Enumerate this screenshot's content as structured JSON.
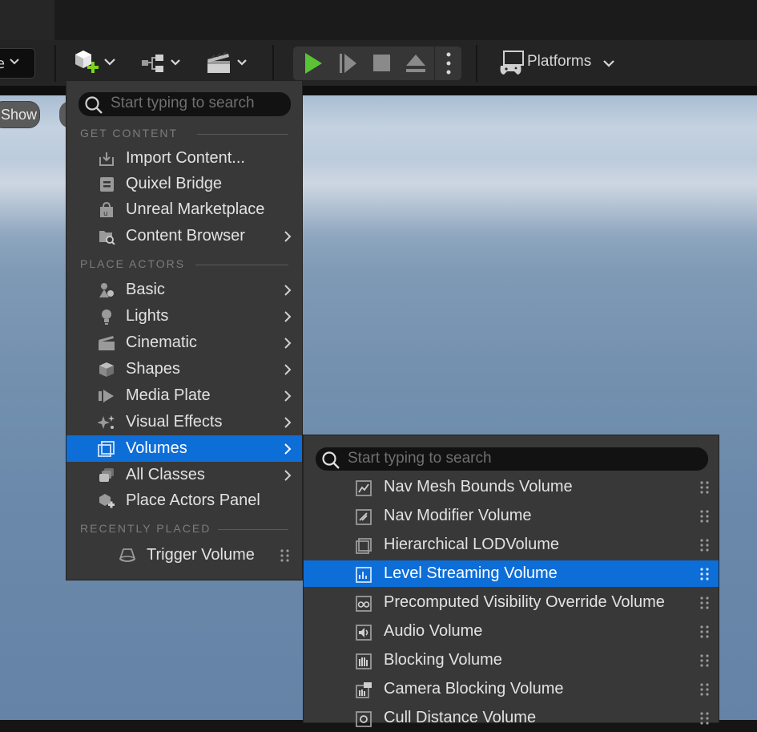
{
  "toolbar": {
    "mode_text": "e",
    "platforms_label": "Platforms"
  },
  "viewport": {
    "show_label": "Show"
  },
  "menu": {
    "search_placeholder": "Start typing to search",
    "sections": {
      "get_content": "GET CONTENT",
      "place_actors": "PLACE ACTORS",
      "recently_placed": "RECENTLY PLACED"
    },
    "items": [
      {
        "label": "Import Content...",
        "icon": "import-icon",
        "submenu": false
      },
      {
        "label": "Quixel Bridge",
        "icon": "bridge-icon",
        "submenu": false
      },
      {
        "label": "Unreal Marketplace",
        "icon": "marketplace-icon",
        "submenu": false
      },
      {
        "label": "Content Browser",
        "icon": "folder-search-icon",
        "submenu": true
      },
      {
        "label": "Basic",
        "icon": "basic-actors-icon",
        "submenu": true
      },
      {
        "label": "Lights",
        "icon": "bulb-icon",
        "submenu": true
      },
      {
        "label": "Cinematic",
        "icon": "clapper-icon",
        "submenu": true
      },
      {
        "label": "Shapes",
        "icon": "cube-icon",
        "submenu": true
      },
      {
        "label": "Media Plate",
        "icon": "media-plate-icon",
        "submenu": true
      },
      {
        "label": "Visual Effects",
        "icon": "sparkles-icon",
        "submenu": true
      },
      {
        "label": "Volumes",
        "icon": "volume-icon",
        "submenu": true,
        "selected": true
      },
      {
        "label": "All Classes",
        "icon": "classes-icon",
        "submenu": true
      },
      {
        "label": "Place Actors Panel",
        "icon": "place-actor-icon",
        "submenu": false
      }
    ],
    "recent": [
      {
        "label": "Trigger Volume",
        "icon": "trigger-volume-icon"
      }
    ]
  },
  "volumes_menu": {
    "search_placeholder": "Start typing to search",
    "items": [
      {
        "label": "Nav Mesh Bounds Volume",
        "icon": "nav-mesh-icon"
      },
      {
        "label": "Nav Modifier Volume",
        "icon": "nav-modifier-icon"
      },
      {
        "label": "Hierarchical LODVolume",
        "icon": "lod-volume-icon"
      },
      {
        "label": "Level Streaming Volume",
        "icon": "level-streaming-icon",
        "selected": true
      },
      {
        "label": "Precomputed Visibility Override Volume",
        "icon": "visibility-override-icon"
      },
      {
        "label": "Audio Volume",
        "icon": "audio-volume-icon"
      },
      {
        "label": "Blocking Volume",
        "icon": "blocking-volume-icon"
      },
      {
        "label": "Camera Blocking Volume",
        "icon": "camera-blocking-icon"
      },
      {
        "label": "Cull Distance Volume",
        "icon": "cull-distance-icon"
      }
    ]
  },
  "colors": {
    "accent": "#0e6ed8",
    "play_green": "#5bc236",
    "add_green": "#7ed321",
    "menu_bg": "#383838"
  }
}
